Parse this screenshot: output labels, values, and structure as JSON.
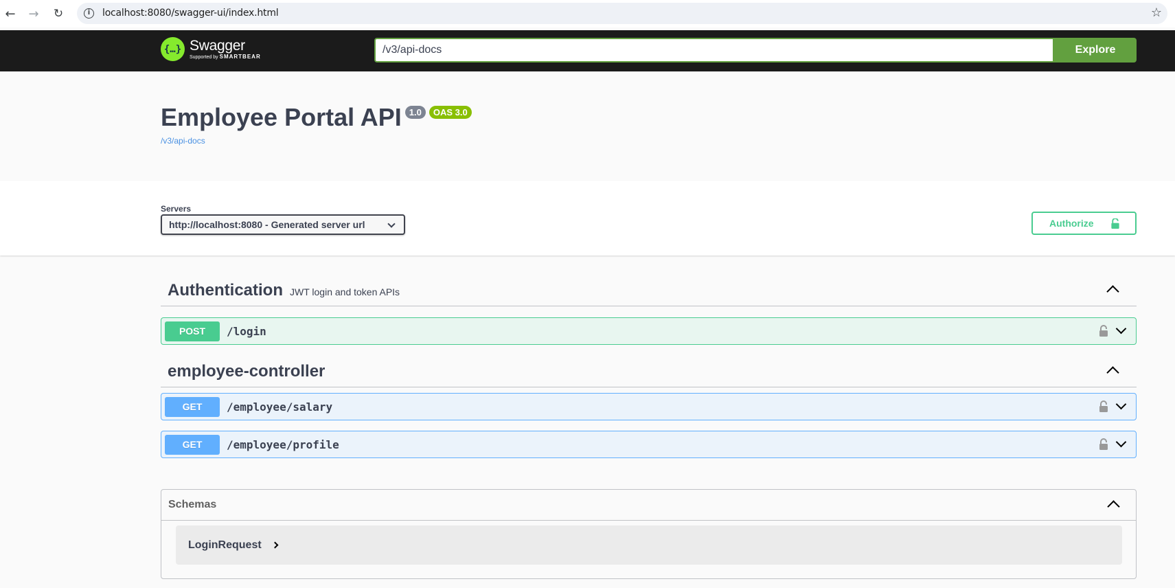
{
  "browser": {
    "url": "localhost:8080/swagger-ui/index.html"
  },
  "topbar": {
    "logo_title": "Swagger",
    "logo_sub_prefix": "Supported by",
    "logo_sub_brand": "SMARTBEAR",
    "logo_glyph": "{…}",
    "spec_url": "/v3/api-docs",
    "explore_label": "Explore"
  },
  "info": {
    "title": "Employee Portal API",
    "version": "1.0",
    "oas": "OAS 3.0",
    "spec_link": "/v3/api-docs"
  },
  "servers": {
    "label": "Servers",
    "selected": "http://localhost:8080 - Generated server url"
  },
  "authorize": {
    "label": "Authorize"
  },
  "tags": [
    {
      "name": "Authentication",
      "description": "JWT login and token APIs",
      "operations": [
        {
          "method": "POST",
          "path": "/login"
        }
      ]
    },
    {
      "name": "employee-controller",
      "description": "",
      "operations": [
        {
          "method": "GET",
          "path": "/employee/salary"
        },
        {
          "method": "GET",
          "path": "/employee/profile"
        }
      ]
    }
  ],
  "schemas": {
    "title": "Schemas",
    "items": [
      "LoginRequest"
    ]
  },
  "colors": {
    "post": "#49cc90",
    "get": "#61affe",
    "explore": "#62a03f",
    "topbar": "#1b1b1b"
  }
}
